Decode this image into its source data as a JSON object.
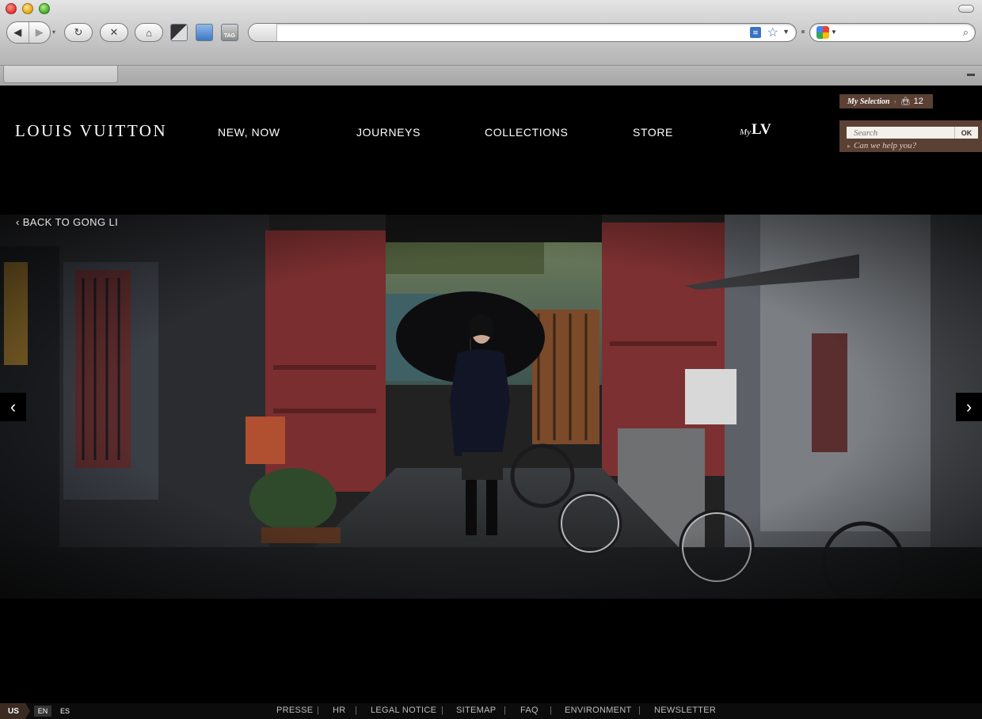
{
  "browser": {
    "url": "",
    "search_value": ""
  },
  "site": {
    "logo": "LOUIS VUITTON",
    "nav": [
      "NEW, NOW",
      "JOURNEYS",
      "COLLECTIONS",
      "STORE"
    ],
    "mylv_my": "My",
    "mylv_lv": "LV",
    "my_selection": {
      "label": "My Selection",
      "count": "12"
    },
    "search": {
      "placeholder": "Search",
      "ok": "OK",
      "help": "Can we help you?"
    }
  },
  "content": {
    "back_link": "‹ BACK TO GONG LI",
    "prev_icon": "chevron-left-icon",
    "next_icon": "chevron-right-icon"
  },
  "footer": {
    "region": "US",
    "languages": [
      "EN",
      "ES"
    ],
    "links": [
      "PRESSE",
      "HR",
      "LEGAL NOTICE",
      "SITEMAP",
      "FAQ",
      "ENVIRONMENT",
      "NEWSLETTER"
    ],
    "separator": "|"
  },
  "colors": {
    "brand_brown": "#5b4034",
    "page_bg": "#000000"
  }
}
